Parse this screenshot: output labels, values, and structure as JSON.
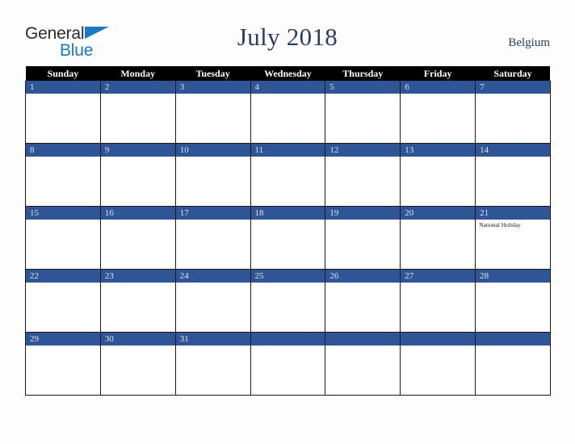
{
  "brand": {
    "name_part1": "General",
    "name_part2": "Blue",
    "color_dark": "#2b2b2b",
    "color_blue": "#1b7ac4"
  },
  "header": {
    "title": "July 2018",
    "country": "Belgium",
    "title_color": "#2a3d62"
  },
  "calendar": {
    "month": "July",
    "year": "2018",
    "accent_color": "#2f5597",
    "header_bg": "#000000",
    "weekday_headers": [
      "Sunday",
      "Monday",
      "Tuesday",
      "Wednesday",
      "Thursday",
      "Friday",
      "Saturday"
    ],
    "weeks": [
      [
        {
          "day": "1",
          "events": []
        },
        {
          "day": "2",
          "events": []
        },
        {
          "day": "3",
          "events": []
        },
        {
          "day": "4",
          "events": []
        },
        {
          "day": "5",
          "events": []
        },
        {
          "day": "6",
          "events": []
        },
        {
          "day": "7",
          "events": []
        }
      ],
      [
        {
          "day": "8",
          "events": []
        },
        {
          "day": "9",
          "events": []
        },
        {
          "day": "10",
          "events": []
        },
        {
          "day": "11",
          "events": []
        },
        {
          "day": "12",
          "events": []
        },
        {
          "day": "13",
          "events": []
        },
        {
          "day": "14",
          "events": []
        }
      ],
      [
        {
          "day": "15",
          "events": []
        },
        {
          "day": "16",
          "events": []
        },
        {
          "day": "17",
          "events": []
        },
        {
          "day": "18",
          "events": []
        },
        {
          "day": "19",
          "events": []
        },
        {
          "day": "20",
          "events": []
        },
        {
          "day": "21",
          "events": [
            "National Holiday"
          ]
        }
      ],
      [
        {
          "day": "22",
          "events": []
        },
        {
          "day": "23",
          "events": []
        },
        {
          "day": "24",
          "events": []
        },
        {
          "day": "25",
          "events": []
        },
        {
          "day": "26",
          "events": []
        },
        {
          "day": "27",
          "events": []
        },
        {
          "day": "28",
          "events": []
        }
      ],
      [
        {
          "day": "29",
          "events": []
        },
        {
          "day": "30",
          "events": []
        },
        {
          "day": "31",
          "events": []
        },
        {
          "day": "",
          "events": []
        },
        {
          "day": "",
          "events": []
        },
        {
          "day": "",
          "events": []
        },
        {
          "day": "",
          "events": []
        }
      ]
    ]
  }
}
